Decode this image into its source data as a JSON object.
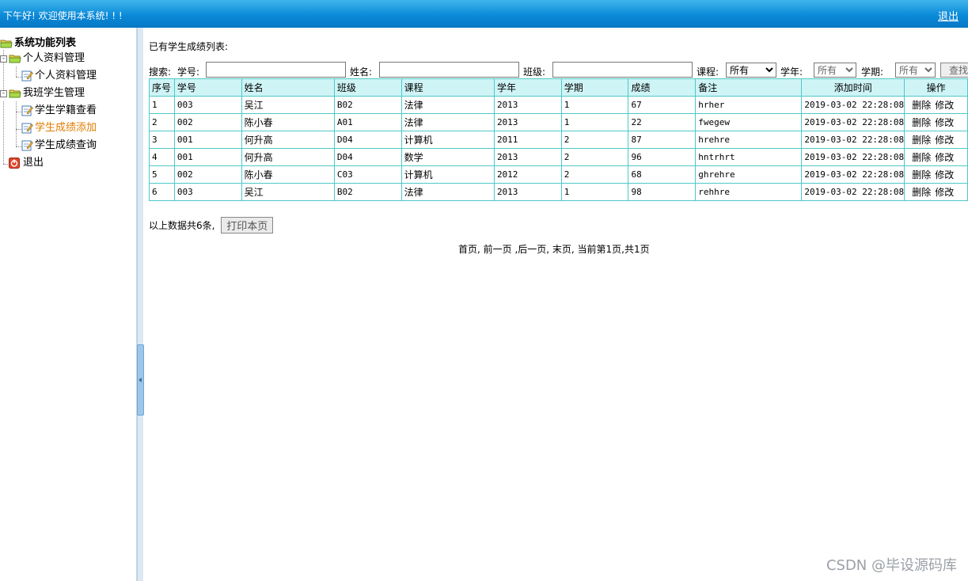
{
  "header": {
    "welcome_text": "下午好! 欢迎使用本系统! ! !",
    "logout_label": "退出"
  },
  "sidebar": {
    "root_label": "系统功能列表",
    "groups": [
      {
        "label": "个人资料管理",
        "items": [
          {
            "label": "个人资料管理"
          }
        ]
      },
      {
        "label": "我班学生管理",
        "items": [
          {
            "label": "学生学籍查看"
          },
          {
            "label": "学生成绩添加"
          },
          {
            "label": "学生成绩查询"
          }
        ]
      }
    ],
    "exit_label": "退出",
    "active_item": "学生成绩添加"
  },
  "main": {
    "list_title": "已有学生成绩列表:",
    "search": {
      "label": "搜索:",
      "student_no_label": "学号:",
      "student_no_value": "",
      "name_label": "姓名:",
      "name_value": "",
      "class_label": "班级:",
      "class_value": "",
      "course_label": "课程:",
      "course_selected": "所有",
      "year_label": "学年:",
      "year_selected": "所有",
      "term_label": "学期:",
      "term_selected": "所有",
      "find_button": "查找"
    },
    "table": {
      "columns": [
        "序号",
        "学号",
        "姓名",
        "班级",
        "课程",
        "学年",
        "学期",
        "成绩",
        "备注",
        "添加时间",
        "操作"
      ],
      "rows": [
        [
          "1",
          "003",
          "吴江",
          "B02",
          "法律",
          "2013",
          "1",
          "67",
          "hrher",
          "2019-03-02 22:28:08"
        ],
        [
          "2",
          "002",
          "陈小春",
          "A01",
          "法律",
          "2013",
          "1",
          "22",
          "fwegew",
          "2019-03-02 22:28:08"
        ],
        [
          "3",
          "001",
          "何升高",
          "D04",
          "计算机",
          "2011",
          "2",
          "87",
          "hrehre",
          "2019-03-02 22:28:08"
        ],
        [
          "4",
          "001",
          "何升高",
          "D04",
          "数学",
          "2013",
          "2",
          "96",
          "hntrhrt",
          "2019-03-02 22:28:08"
        ],
        [
          "5",
          "002",
          "陈小春",
          "C03",
          "计算机",
          "2012",
          "2",
          "68",
          "ghrehre",
          "2019-03-02 22:28:08"
        ],
        [
          "6",
          "003",
          "吴江",
          "B02",
          "法律",
          "2013",
          "1",
          "98",
          "rehhre",
          "2019-03-02 22:28:08"
        ]
      ],
      "delete_label": "删除",
      "edit_label": "修改"
    },
    "summary_text": "以上数据共6条,",
    "print_button": "打印本页",
    "pager_text": "首页, 前一页 ,后一页, 末页, 当前第1页,共1页"
  },
  "watermark": "CSDN @毕设源码库",
  "colors": {
    "topbar": "#0a8ad8",
    "table_border": "#4ec8c8",
    "table_header_bg": "#cff4f6",
    "active_menu": "#e07c00"
  }
}
